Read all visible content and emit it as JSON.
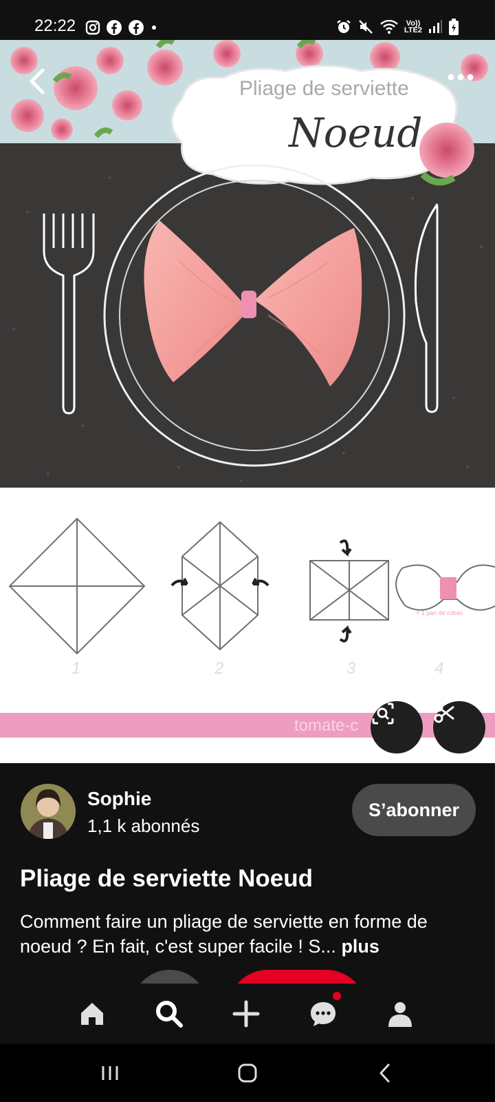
{
  "status_bar": {
    "time": "22:22",
    "left_icons": [
      "instagram-icon",
      "facebook-icon",
      "facebook-icon",
      "dot-icon"
    ],
    "right_icons": [
      "alarm-icon",
      "mute-icon",
      "wifi-icon",
      "signal-icon",
      "battery-icon"
    ],
    "network_label_top": "Vo))",
    "network_label_bottom": "LTE2"
  },
  "pin_image": {
    "title_line1": "Pliage de serviette",
    "title_line2": "Noeud",
    "step_numbers": [
      "1",
      "2",
      "3",
      "4"
    ],
    "step4_note": "+ 1 pan de ruban",
    "watermark": "tomate-c"
  },
  "toolbar": {
    "back_icon": "chevron-left-icon",
    "more_icon": "more-horizontal-icon",
    "lens_icon": "visual-search-icon",
    "scissors_icon": "scissors-icon"
  },
  "author": {
    "name": "Sophie",
    "followers": "1,1 k abonnés",
    "follow_label": "S’abonner"
  },
  "pin": {
    "title": "Pliage de serviette Noeud",
    "description": "Comment faire un pliage de serviette en forme de noeud ? En fait, c'est super facile ! S...",
    "more_label": "plus"
  },
  "bottom_nav": [
    "home-icon",
    "search-icon",
    "create-icon",
    "messages-icon",
    "profile-icon"
  ],
  "system_nav": [
    "recent-apps-icon",
    "home-icon",
    "back-icon"
  ],
  "colors": {
    "background": "#111111",
    "accent_red": "#e60023",
    "follow_button": "#4a4a4a",
    "napkin_pink": "#f4a3a3",
    "ribbon_pink": "#ee8fb4"
  }
}
